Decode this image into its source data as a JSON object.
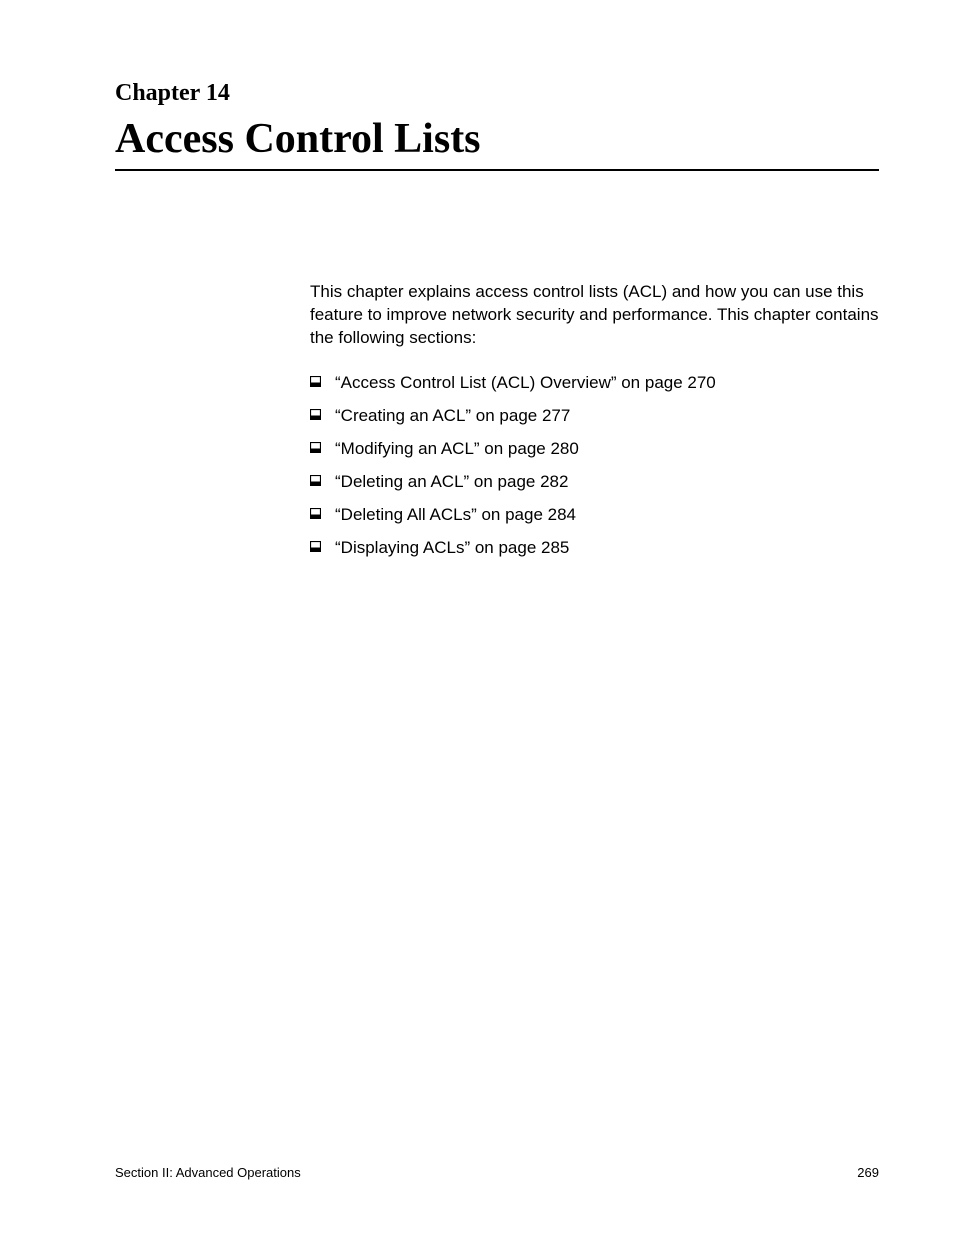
{
  "chapter": {
    "label": "Chapter 14",
    "title": "Access Control Lists"
  },
  "intro": "This chapter explains access control lists (ACL) and how you can use this feature to improve network security and performance. This chapter contains the following sections:",
  "toc": [
    "“Access Control List (ACL) Overview” on page 270",
    "“Creating an ACL” on page 277",
    "“Modifying an ACL” on page 280",
    "“Deleting an ACL” on page 282",
    "“Deleting All ACLs” on page 284",
    "“Displaying ACLs” on page 285"
  ],
  "footer": {
    "section": "Section II: Advanced Operations",
    "page": "269"
  }
}
